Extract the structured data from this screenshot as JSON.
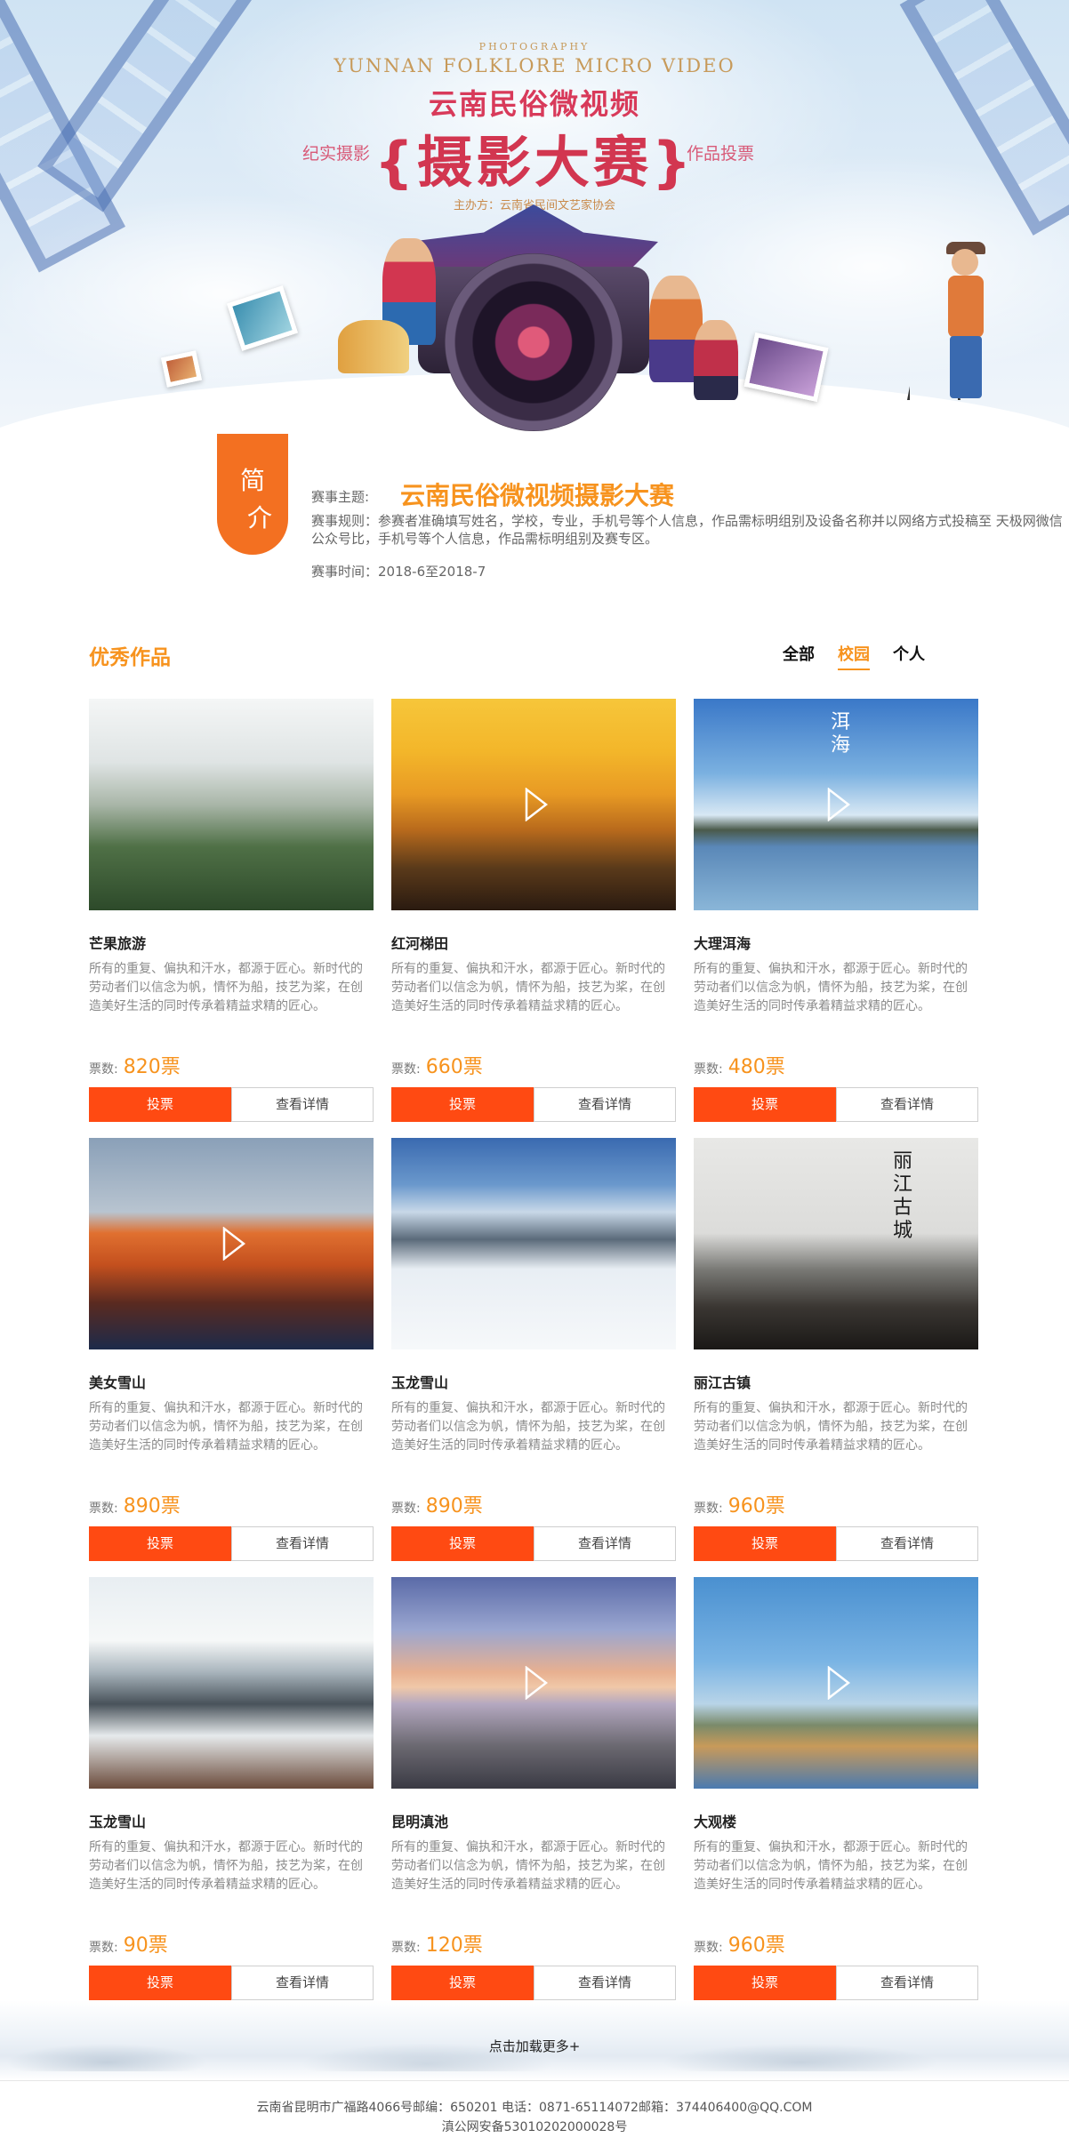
{
  "hero": {
    "subtitle_small": "PHOTOGRAPHY",
    "subtitle_en": "YUNNAN FOLKLORE MICRO VIDEO",
    "title_line1": "云南民俗微视频",
    "title_line2": "{摄影大赛}",
    "side_left": "纪实摄影",
    "side_right": "作品投票",
    "organizer_label": "主办方：",
    "organizer_value": "云南省民间文艺家协会"
  },
  "intro": {
    "badge_line1": "简",
    "badge_line2": "介",
    "topic_label": "赛事主题:",
    "topic_value": "云南民俗微视频摄影大赛",
    "rules": "赛事规则：参赛者准确填写姓名，学校，专业，手机号等个人信息，作品需标明组别及设备名称并以网络方式投稿至 天极网微信公众号比，手机号等个人信息，作品需标明组别及赛专区。",
    "time": "赛事时间：2018-6至2018-7"
  },
  "works": {
    "section_title": "优秀作品",
    "tabs": [
      "全部",
      "校园",
      "个人"
    ],
    "active_tab": "校园",
    "votes_label": "票数:",
    "vote_button": "投票",
    "detail_button": "查看详情",
    "items": [
      {
        "title": "芒果旅游",
        "desc": "所有的重复、偏执和汗水，都源于匠心。新时代的劳动者们以信念为帆，情怀为船，技艺为桨，在创造美好生活的同时传承着精益求精的匠心。",
        "votes": "820票",
        "video": false,
        "scene": "mist"
      },
      {
        "title": "红河梯田",
        "desc": "所有的重复、偏执和汗水，都源于匠心。新时代的劳动者们以信念为帆，情怀为船，技艺为桨，在创造美好生活的同时传承着精益求精的匠心。",
        "votes": "660票",
        "video": true,
        "scene": "terrace"
      },
      {
        "title": "大理洱海",
        "desc": "所有的重复、偏执和汗水，都源于匠心。新时代的劳动者们以信念为帆，情怀为船，技艺为桨，在创造美好生活的同时传承着精益求精的匠心。",
        "votes": "480票",
        "video": true,
        "scene": "lake",
        "overlay_text": "洱海"
      },
      {
        "title": "美女雪山",
        "desc": "所有的重复、偏执和汗水，都源于匠心。新时代的劳动者们以信念为帆，情怀为船，技艺为桨，在创造美好生活的同时传承着精益求精的匠心。",
        "votes": "890票",
        "video": true,
        "scene": "sunset-mountain"
      },
      {
        "title": "玉龙雪山",
        "desc": "所有的重复、偏执和汗水，都源于匠心。新时代的劳动者们以信念为帆，情怀为船，技艺为桨，在创造美好生活的同时传承着精益求精的匠心。",
        "votes": "890票",
        "video": false,
        "scene": "snow-aerial"
      },
      {
        "title": "丽江古镇",
        "desc": "所有的重复、偏执和汗水，都源于匠心。新时代的劳动者们以信念为帆，情怀为船，技艺为桨，在创造美好生活的同时传承着精益求精的匠心。",
        "votes": "960票",
        "video": false,
        "scene": "old-town",
        "overlay_text": "丽江古城"
      },
      {
        "title": "玉龙雪山",
        "desc": "所有的重复、偏执和汗水，都源于匠心。新时代的劳动者们以信念为帆，情怀为船，技艺为桨，在创造美好生活的同时传承着精益求精的匠心。",
        "votes": "90票",
        "video": false,
        "scene": "snow-mountain"
      },
      {
        "title": "昆明滇池",
        "desc": "所有的重复、偏执和汗水，都源于匠心。新时代的劳动者们以信念为帆，情怀为船，技艺为桨，在创造美好生活的同时传承着精益求精的匠心。",
        "votes": "120票",
        "video": true,
        "scene": "pier"
      },
      {
        "title": "大观楼",
        "desc": "所有的重复、偏执和汗水，都源于匠心。新时代的劳动者们以信念为帆，情怀为船，技艺为桨，在创造美好生活的同时传承着精益求精的匠心。",
        "votes": "960票",
        "video": true,
        "scene": "gull-lake"
      }
    ]
  },
  "load_more": "点击加载更多+",
  "footer": {
    "line1": "云南省昆明市广福路4066号邮编：650201 电话：0871-65114072邮箱：374406400@QQ.COM",
    "line2": "滇公网安备53010202000028号"
  },
  "colors": {
    "accent_orange": "#f7931e",
    "vote_red": "#ff4a12",
    "badge_orange": "#f37021"
  }
}
